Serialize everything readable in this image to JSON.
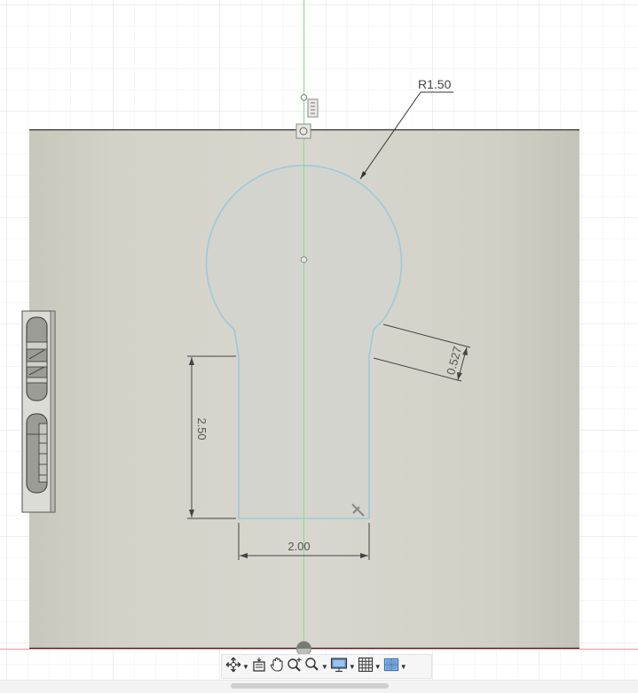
{
  "dimensions": {
    "radius_label": "R1.50",
    "height_label": "2.50",
    "width_label": "2.00",
    "angled_label": "0.527"
  },
  "toolbar": {
    "tools": [
      {
        "name": "orbit-icon",
        "has_dropdown": true
      },
      {
        "name": "look-at-icon",
        "has_dropdown": false
      },
      {
        "name": "pan-icon",
        "has_dropdown": false
      },
      {
        "name": "zoom-icon",
        "has_dropdown": false
      },
      {
        "name": "zoom-window-icon",
        "has_dropdown": true
      },
      {
        "name": "display-settings-icon",
        "has_dropdown": true
      },
      {
        "name": "grid-settings-icon",
        "has_dropdown": true
      },
      {
        "name": "viewports-icon",
        "has_dropdown": true
      }
    ]
  },
  "colors": {
    "sketch_line": "#9cc9dc",
    "axis_green": "#8fd68f",
    "axis_red": "#e89a9a",
    "plate_fill": "#cfcec4"
  }
}
